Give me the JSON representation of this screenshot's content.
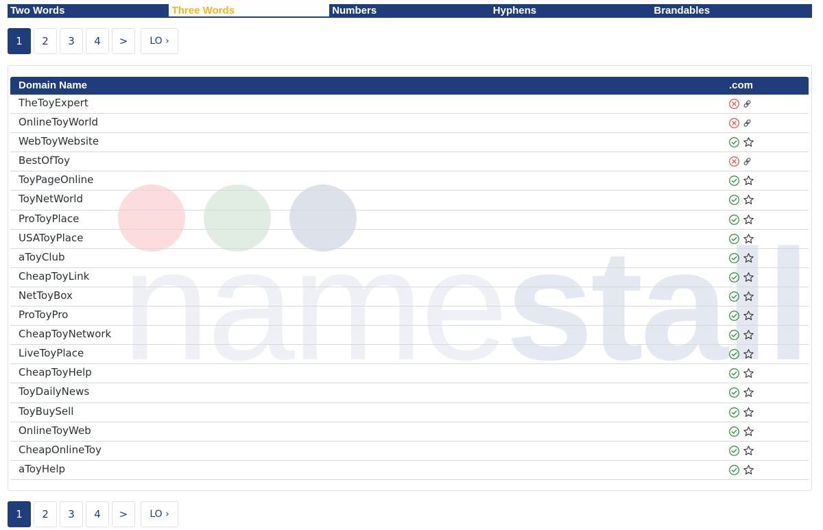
{
  "tabs": [
    {
      "label": "Two Words",
      "active": false
    },
    {
      "label": "Three Words",
      "active": true
    },
    {
      "label": "Numbers",
      "active": false
    },
    {
      "label": "Hyphens",
      "active": false
    },
    {
      "label": "Brandables",
      "active": false
    }
  ],
  "pagination": {
    "pages": [
      "1",
      "2",
      "3",
      "4"
    ],
    "current": "1",
    "next_label": ">",
    "extra_label": "LO ›"
  },
  "table": {
    "col_name": "Domain Name",
    "col_tld": ".com",
    "rows": [
      {
        "name": "TheToyExpert",
        "available": false
      },
      {
        "name": "OnlineToyWorld",
        "available": false
      },
      {
        "name": "WebToyWebsite",
        "available": true
      },
      {
        "name": "BestOfToy",
        "available": false
      },
      {
        "name": "ToyPageOnline",
        "available": true
      },
      {
        "name": "ToyNetWorld",
        "available": true
      },
      {
        "name": "ProToyPlace",
        "available": true
      },
      {
        "name": "USAToyPlace",
        "available": true
      },
      {
        "name": "aToyClub",
        "available": true
      },
      {
        "name": "CheapToyLink",
        "available": true
      },
      {
        "name": "NetToyBox",
        "available": true
      },
      {
        "name": "ProToyPro",
        "available": true
      },
      {
        "name": "CheapToyNetwork",
        "available": true
      },
      {
        "name": "LiveToyPlace",
        "available": true
      },
      {
        "name": "CheapToyHelp",
        "available": true
      },
      {
        "name": "ToyDailyNews",
        "available": true
      },
      {
        "name": "ToyBuySell",
        "available": true
      },
      {
        "name": "OnlineToyWeb",
        "available": true
      },
      {
        "name": "CheapOnlineToy",
        "available": true
      },
      {
        "name": "aToyHelp",
        "available": true
      }
    ]
  },
  "watermark": {
    "text_light": "name",
    "text_bold": "stall",
    "dot_colors": [
      "#fcdcdc",
      "#e1ede3",
      "#dde1ea"
    ]
  },
  "colors": {
    "brand": "#1f3d7a",
    "accent": "#f4b71e",
    "available": "#2e8b3e",
    "taken": "#d9534f"
  },
  "icons": {
    "available": "check-circle-icon",
    "favorite": "star-icon",
    "taken": "x-circle-icon",
    "link": "link-icon"
  }
}
